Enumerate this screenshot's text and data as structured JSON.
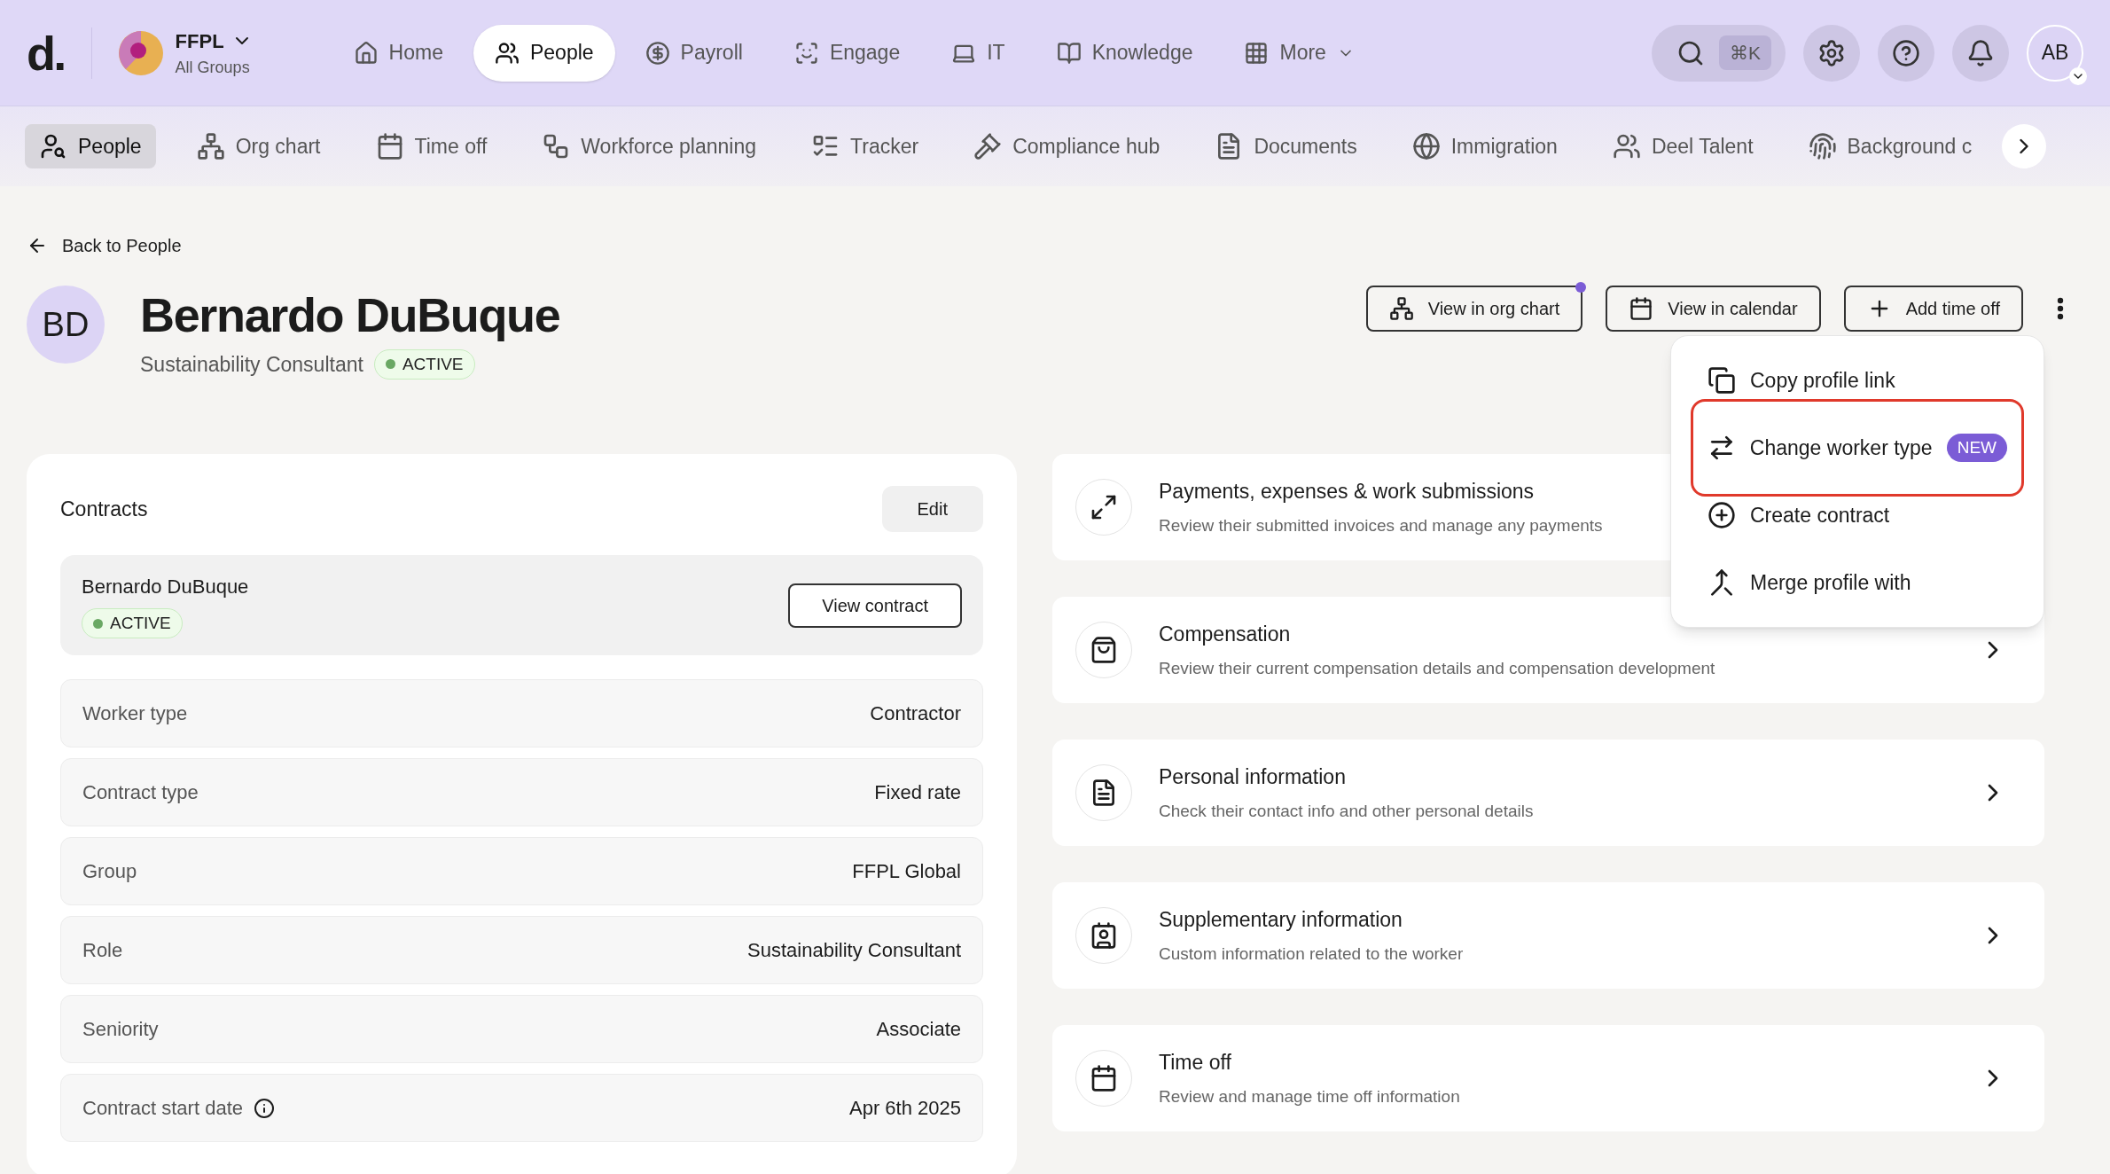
{
  "logo": "d.",
  "org": {
    "name": "FFPL",
    "subtitle": "All Groups"
  },
  "top_nav": [
    {
      "label": "Home",
      "selected": false
    },
    {
      "label": "People",
      "selected": true
    },
    {
      "label": "Payroll",
      "selected": false
    },
    {
      "label": "Engage",
      "selected": false
    },
    {
      "label": "IT",
      "selected": false
    },
    {
      "label": "Knowledge",
      "selected": false
    },
    {
      "label": "More",
      "selected": false
    }
  ],
  "search_shortcut": "⌘K",
  "user_avatar": "AB",
  "sub_nav": [
    {
      "label": "People",
      "selected": true
    },
    {
      "label": "Org chart",
      "selected": false
    },
    {
      "label": "Time off",
      "selected": false
    },
    {
      "label": "Workforce planning",
      "selected": false
    },
    {
      "label": "Tracker",
      "selected": false
    },
    {
      "label": "Compliance hub",
      "selected": false
    },
    {
      "label": "Documents",
      "selected": false
    },
    {
      "label": "Immigration",
      "selected": false
    },
    {
      "label": "Deel Talent",
      "selected": false
    },
    {
      "label": "Background c",
      "selected": false
    }
  ],
  "back_link": "Back to People",
  "profile": {
    "initials": "BD",
    "name": "Bernardo DuBuque",
    "title": "Sustainability Consultant",
    "status": "ACTIVE"
  },
  "actions": [
    {
      "label": "View in org chart",
      "dot": true
    },
    {
      "label": "View in calendar",
      "dot": false
    },
    {
      "label": "Add time off",
      "dot": false
    }
  ],
  "menu": [
    {
      "label": "Copy profile link",
      "highlighted": false
    },
    {
      "label": "Change worker type",
      "badge": "NEW",
      "highlighted": true
    },
    {
      "label": "Create contract",
      "highlighted": false
    },
    {
      "label": "Merge profile with",
      "highlighted": false
    }
  ],
  "contracts": {
    "title": "Contracts",
    "edit": "Edit",
    "contract": {
      "name": "Bernardo DuBuque",
      "status": "ACTIVE",
      "button": "View contract"
    },
    "fields": [
      {
        "label": "Worker type",
        "value": "Contractor"
      },
      {
        "label": "Contract type",
        "value": "Fixed rate"
      },
      {
        "label": "Group",
        "value": "FFPL Global"
      },
      {
        "label": "Role",
        "value": "Sustainability Consultant"
      },
      {
        "label": "Seniority",
        "value": "Associate"
      },
      {
        "label": "Contract start date",
        "value": "Apr 6th 2025",
        "info": true
      }
    ]
  },
  "sections": [
    {
      "title": "Payments, expenses & work submissions",
      "description": "Review their submitted invoices and manage any payments"
    },
    {
      "title": "Compensation",
      "description": "Review their current compensation details and compensation development"
    },
    {
      "title": "Personal information",
      "description": "Check their contact info and other personal details"
    },
    {
      "title": "Supplementary information",
      "description": "Custom information related to the worker"
    },
    {
      "title": "Time off",
      "description": "Review and manage time off information"
    }
  ]
}
